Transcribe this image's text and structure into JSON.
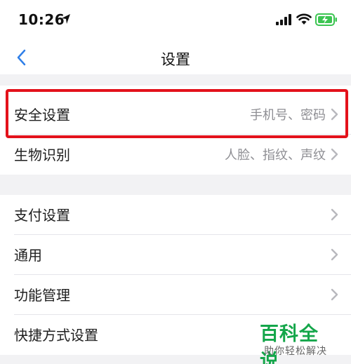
{
  "status_bar": {
    "time": "10:26"
  },
  "nav": {
    "title": "设置"
  },
  "groups": [
    {
      "items": [
        {
          "label": "安全设置",
          "value": "手机号、密码"
        },
        {
          "label": "生物识别",
          "value": "人脸、指纹、声纹"
        }
      ]
    },
    {
      "items": [
        {
          "label": "支付设置",
          "value": ""
        },
        {
          "label": "通用",
          "value": ""
        },
        {
          "label": "功能管理",
          "value": ""
        },
        {
          "label": "快捷方式设置",
          "value": ""
        }
      ]
    }
  ],
  "watermark": {
    "logo": "百科全说",
    "subtitle": "助你轻松解决"
  },
  "colors": {
    "highlight": "#e3121b",
    "accent": "#2f7fe8",
    "battery": "#3cc552",
    "watermark": "#14a64a"
  }
}
